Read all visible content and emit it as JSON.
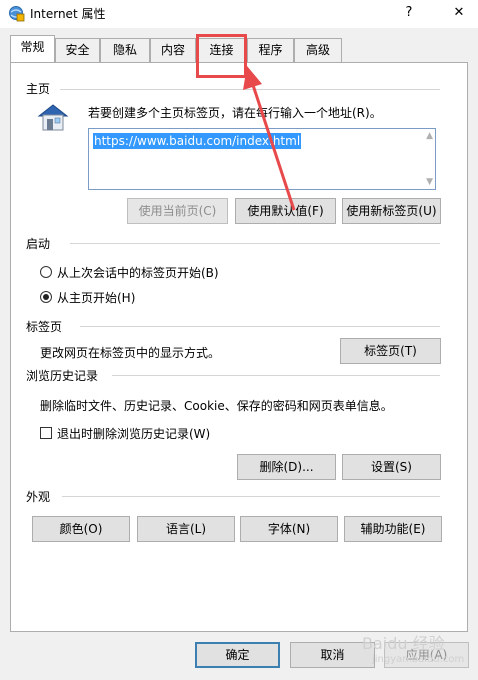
{
  "window": {
    "title": "Internet 属性",
    "help_label": "?",
    "close_label": "✕"
  },
  "tabs": [
    {
      "label": "常规"
    },
    {
      "label": "安全"
    },
    {
      "label": "隐私"
    },
    {
      "label": "内容"
    },
    {
      "label": "连接"
    },
    {
      "label": "程序"
    },
    {
      "label": "高级"
    }
  ],
  "homepage": {
    "section_title": "主页",
    "instruction": "若要创建多个主页标签页，请在每行输入一个地址(R)。",
    "url": "https://www.baidu.com/index.html",
    "use_current_label": "使用当前页(C)",
    "use_default_label": "使用默认值(F)",
    "use_new_tab_label": "使用新标签页(U)"
  },
  "startup": {
    "section_title": "启动",
    "option_last_session": "从上次会话中的标签页开始(B)",
    "option_homepage": "从主页开始(H)",
    "selected": "homepage"
  },
  "tabs_section": {
    "section_title": "标签页",
    "description": "更改网页在标签页中的显示方式。",
    "button_label": "标签页(T)"
  },
  "history": {
    "section_title": "浏览历史记录",
    "description": "删除临时文件、历史记录、Cookie、保存的密码和网页表单信息。",
    "checkbox_label": "退出时删除浏览历史记录(W)",
    "checkbox_checked": false,
    "delete_label": "删除(D)...",
    "settings_label": "设置(S)"
  },
  "appearance": {
    "section_title": "外观",
    "colors_label": "颜色(O)",
    "languages_label": "语言(L)",
    "fonts_label": "字体(N)",
    "accessibility_label": "辅助功能(E)"
  },
  "footer": {
    "ok_label": "确定",
    "cancel_label": "取消",
    "apply_label": "应用(A)"
  },
  "watermark": {
    "text": "Baidu 经验",
    "subtext": "jingyan.baidu.com"
  },
  "colors": {
    "annotation": "#e8494b",
    "selection": "#3399ff"
  }
}
